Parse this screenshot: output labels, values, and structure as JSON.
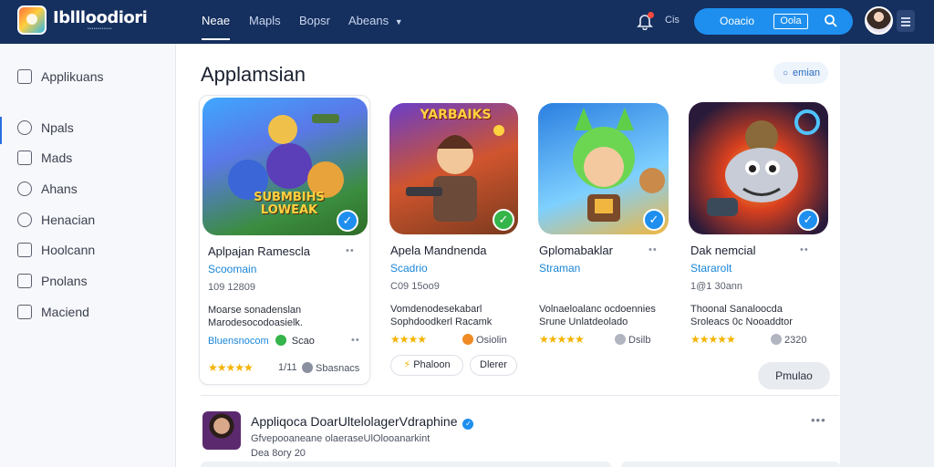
{
  "brand": {
    "name": "Ibllloodiori",
    "tagline": "••••••••••••"
  },
  "nav": {
    "items": [
      {
        "label": "Neae",
        "active": true
      },
      {
        "label": "Mapls",
        "active": false
      },
      {
        "label": "Bopsr",
        "active": false
      },
      {
        "label": "Abeans",
        "active": false
      }
    ],
    "dropdown_icon": "chevron-down-icon"
  },
  "header": {
    "lang": "Cis",
    "search_label": "Ooacio",
    "search_box_text": "Oola",
    "notification_dot": true
  },
  "sidebar": {
    "items": [
      {
        "label": "Applikuans",
        "icon": "apps-icon"
      },
      {
        "label": "Npals",
        "icon": "pin-icon"
      },
      {
        "label": "Mads",
        "icon": "grid-icon"
      },
      {
        "label": "Ahans",
        "icon": "smile-icon"
      },
      {
        "label": "Henacian",
        "icon": "heart-icon"
      },
      {
        "label": "Hoolcann",
        "icon": "chart-icon"
      },
      {
        "label": "Pnolans",
        "icon": "doc-icon"
      },
      {
        "label": "Maciend",
        "icon": "square-icon"
      }
    ]
  },
  "section": {
    "title": "Applamsian",
    "chip": "emian"
  },
  "cards": [
    {
      "title": "Aplpajan Ramescla",
      "subtitle": "Scoomain",
      "meta": "109 12809",
      "desc1": "Moarse sonadenslan",
      "desc2": "Marodesocodoasielk.",
      "link": "Bluensnocom",
      "link2": "Scao",
      "stars": "★★★★★",
      "rating": "1/11",
      "extra": "Sbasnacs",
      "art_text": "SUBMBIHS LOWEAK",
      "badge_color": "#1e8fee"
    },
    {
      "title": "Apela Mandnenda",
      "subtitle": "Scadrio",
      "meta": "C09 15oo9",
      "desc1": "Vomdenodesekabarl",
      "desc2": "Sophdoodkerl Racamk",
      "stars": "★★★★",
      "rating": "Osiolin",
      "pill1": "Phaloon",
      "pill2": "Dlerer",
      "art_text": "YARBAIKS",
      "badge_color": "#35b44a"
    },
    {
      "title": "Gplomabaklar",
      "subtitle": "Straman",
      "meta": "",
      "desc1": "Volnaeloalanc ocdoennies",
      "desc2": "Srune Unlatdeolado",
      "stars": "★★★★★",
      "rating": "Dsilb",
      "art_text": "",
      "badge_color": "#1e8fee"
    },
    {
      "title": "Dak nemcial",
      "subtitle": "Stararolt",
      "meta": "1@1 30ann",
      "desc1": "Thoonal Sanaloocda",
      "desc2": "Sroleacs 0c Nooaddtor",
      "stars": "★★★★★",
      "rating": "2320",
      "art_text": "",
      "badge_color": "#1e8fee"
    }
  ],
  "more_button": "Pmulao",
  "post": {
    "title": "Appliqoca DoarUltelolagerVdraphine",
    "subtitle": "Gfvepooaneane olaeraseUlOlooanarkint",
    "meta": "Dea 8ory 20",
    "more": "•••"
  },
  "colors": {
    "nav_bg": "#152f5e",
    "accent": "#1e8fee",
    "star": "#f5b301",
    "link_green": "#18a45a"
  }
}
